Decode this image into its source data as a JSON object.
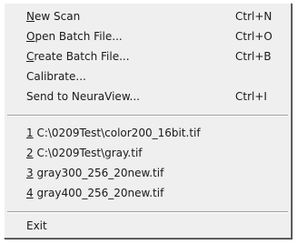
{
  "menu": {
    "commands": [
      {
        "label": "New Scan",
        "shortcut": "Ctrl+N"
      },
      {
        "label": "Open Batch File...",
        "shortcut": "Ctrl+O"
      },
      {
        "label": "Create Batch File...",
        "shortcut": "Ctrl+B"
      },
      {
        "label": "Calibrate...",
        "shortcut": ""
      },
      {
        "label": "Send to NeuraView...",
        "shortcut": "Ctrl+I"
      }
    ],
    "recent_files": [
      {
        "label": "1 C:\\0209Test\\color200_16bit.tif"
      },
      {
        "label": "2 C:\\0209Test\\gray.tif"
      },
      {
        "label": "3 gray300_256_20new.tif"
      },
      {
        "label": "4 gray400_256_20new.tif"
      }
    ],
    "exit": {
      "label": "Exit"
    }
  }
}
